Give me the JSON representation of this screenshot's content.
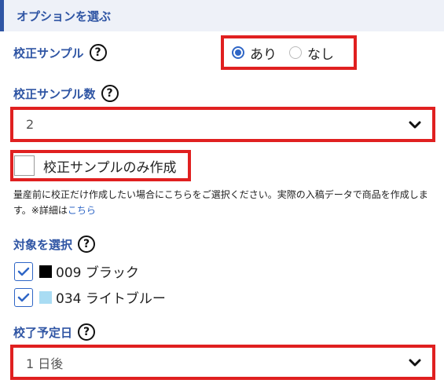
{
  "section": {
    "title": "オプションを選ぶ"
  },
  "proof_sample": {
    "label": "校正サンプル",
    "help_glyph": "?",
    "options": [
      {
        "label": "あり",
        "selected": true
      },
      {
        "label": "なし",
        "selected": false
      }
    ]
  },
  "proof_count": {
    "label": "校正サンプル数",
    "help_glyph": "?",
    "value": "2"
  },
  "only_sample": {
    "label": "校正サンプルのみ作成",
    "checked": false
  },
  "note": {
    "text": "量産前に校正だけ作成したい場合にこちらをご選択ください。実際の入稿データで商品を作成します。※詳細は",
    "link": "こちら"
  },
  "targets": {
    "label": "対象を選択",
    "help_glyph": "?",
    "items": [
      {
        "label": "009 ブラック",
        "color": "#000000",
        "checked": true
      },
      {
        "label": "034 ライトブルー",
        "color": "#a9dcf3",
        "checked": true
      }
    ]
  },
  "due_date": {
    "label": "校了予定日",
    "help_glyph": "?",
    "value": "1 日後"
  },
  "colors": {
    "accent": "#2f55a4",
    "link": "#2f66c6",
    "highlight_frame": "#e02020"
  }
}
